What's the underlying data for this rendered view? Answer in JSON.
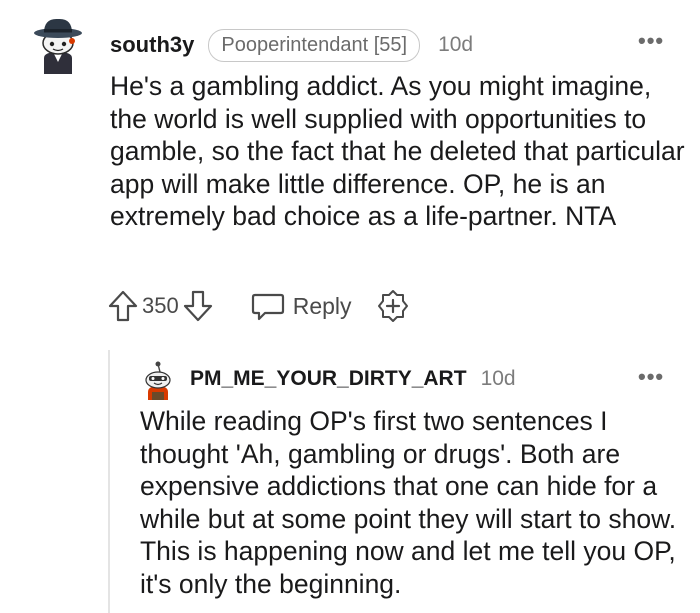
{
  "comment": {
    "avatar_icon": "snoo-avatar-fedora-icon",
    "username": "south3y",
    "flair": "Pooperintendant [55]",
    "age": "10d",
    "more_label": "•••",
    "body": "He's a gambling addict. As you might imagine, the world is well supplied with opportunities to gamble, so the fact that he deleted that particular app will make little difference. OP, he is an extremely bad choice as a life-partner. NTA",
    "actions": {
      "upvote_icon": "upvote-arrow-icon",
      "score": "350",
      "downvote_icon": "downvote-arrow-icon",
      "reply_icon": "speech-bubble-icon",
      "reply_label": "Reply",
      "award_icon": "award-plus-icon"
    }
  },
  "reply": {
    "avatar_icon": "snoo-avatar-icon",
    "username": "PM_ME_YOUR_DIRTY_ART",
    "age": "10d",
    "more_label": "•••",
    "body": "While reading OP's first two sentences I thought 'Ah, gambling or drugs'. Both are expensive addictions that one can hide for a while but at some point they will start to show. This is happening now and let me tell you OP, it's only the beginning."
  },
  "colors": {
    "text": "#1a1a1b",
    "muted": "#7c7c7c",
    "border": "#c8c8c8",
    "accent_red": "#d93a00",
    "thread_line": "#e4e4e4"
  }
}
